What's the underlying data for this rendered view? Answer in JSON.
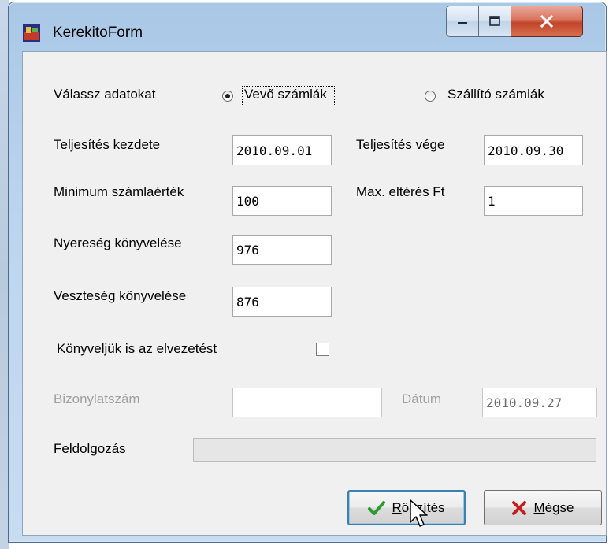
{
  "window": {
    "title": "KerekitoForm",
    "controls": {
      "minimize": "minimize",
      "maximize": "maximize",
      "close": "close"
    }
  },
  "selection": {
    "label": "Válassz adatokat",
    "options": [
      {
        "label": "Vevő számlák",
        "selected": true
      },
      {
        "label": "Szállító számlák",
        "selected": false
      }
    ]
  },
  "fields": {
    "teljesites_kezdete": {
      "label": "Teljesítés kezdete",
      "value": "2010.09.01"
    },
    "teljesites_vege": {
      "label": "Teljesítés vége",
      "value": "2010.09.30"
    },
    "minimum_szamlaertek": {
      "label": "Minimum számlaérték",
      "value": "100"
    },
    "max_elteres": {
      "label": "Max. eltérés Ft",
      "value": "1"
    },
    "nyereseg": {
      "label": "Nyereség könyvelése",
      "value": "976"
    },
    "veszteseg": {
      "label": "Veszteség könyvelése",
      "value": "876"
    },
    "bizonylatszam": {
      "label": "Bizonylatszám",
      "value": ""
    },
    "datum": {
      "label": "Dátum",
      "value": "2010.09.27"
    }
  },
  "checkbox": {
    "label": "Könyveljük is az elvezetést",
    "checked": false
  },
  "progress": {
    "label": "Feldolgozás",
    "value": 0
  },
  "buttons": {
    "save": "Rögzítés",
    "cancel": "Mégse"
  },
  "colors": {
    "ok_check": "#2e9a2e",
    "cancel_x": "#c0201f",
    "close_button": "#c7472c"
  }
}
